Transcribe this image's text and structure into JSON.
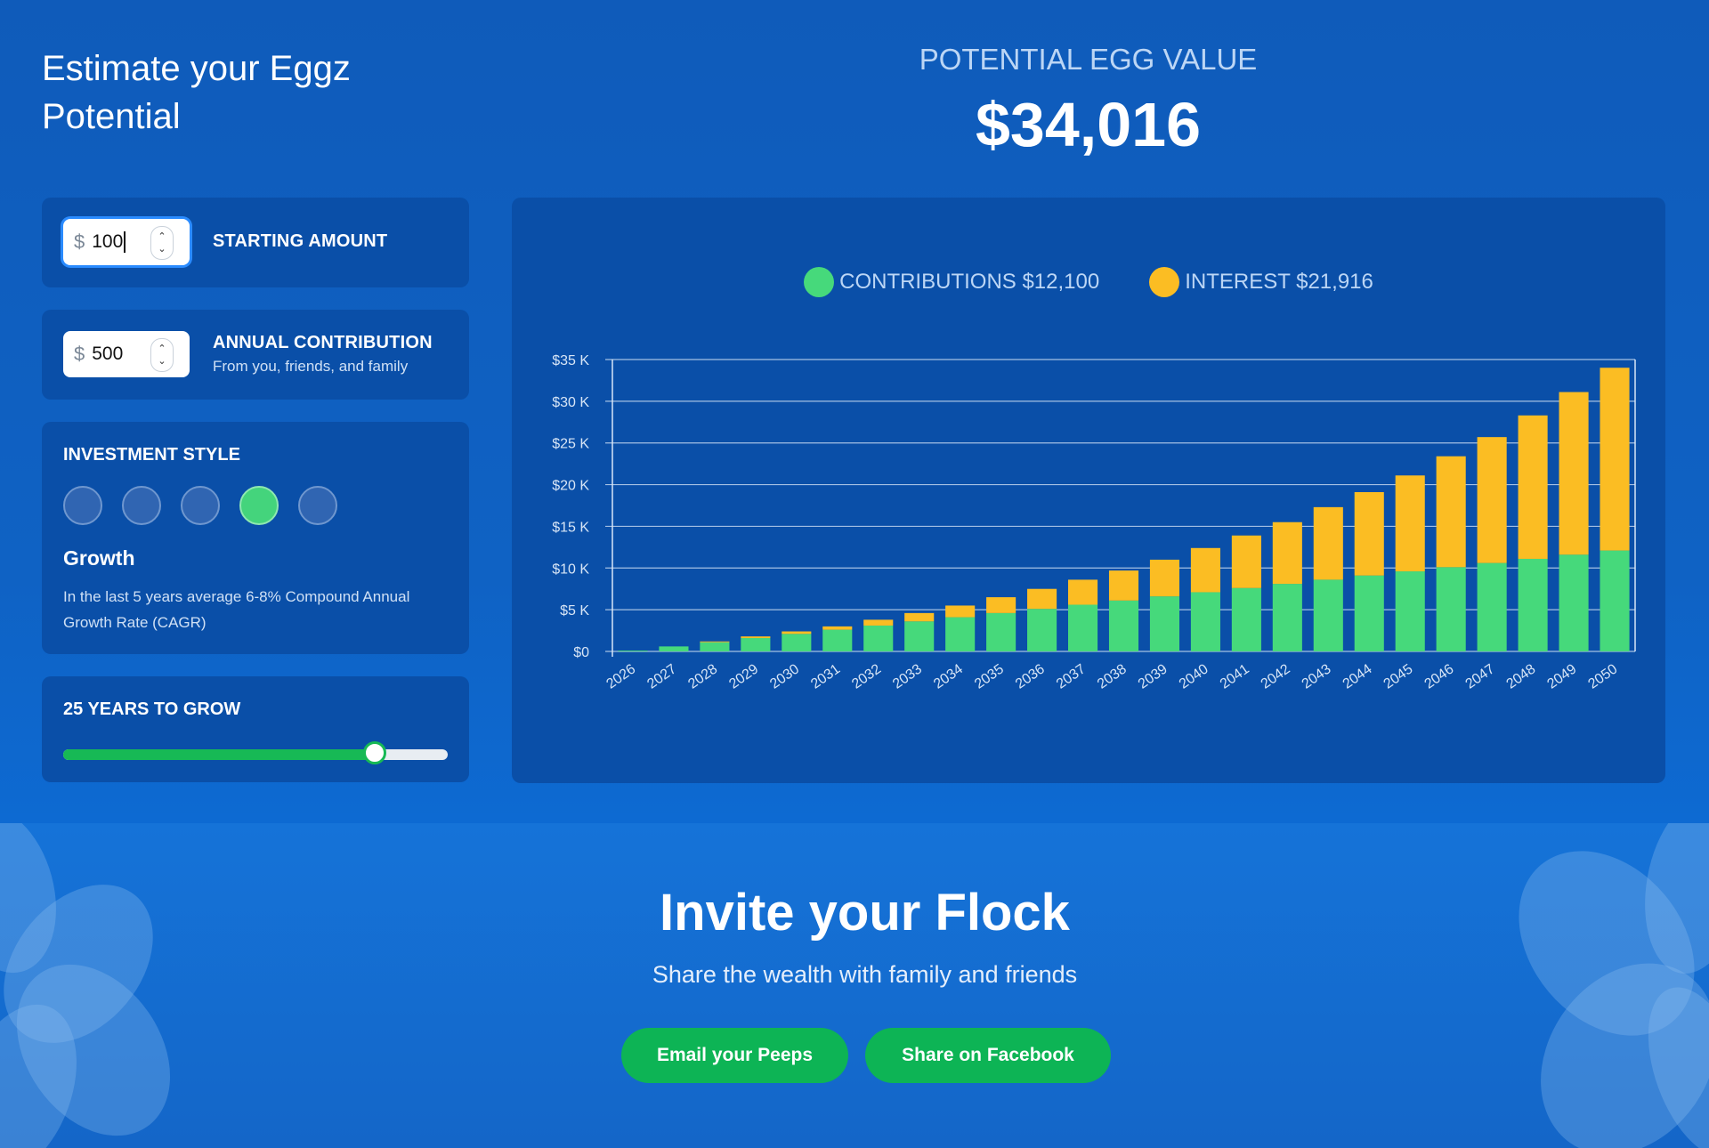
{
  "page": {
    "title": "Estimate your Eggz Potential"
  },
  "starting_amount": {
    "currency": "$",
    "value": "100",
    "label": "STARTING AMOUNT"
  },
  "annual_contribution": {
    "currency": "$",
    "value": "500",
    "label": "ANNUAL CONTRIBUTION",
    "sub": "From you, friends, and family"
  },
  "investment_style": {
    "label": "INVESTMENT STYLE",
    "options_count": 5,
    "selected_index": 3,
    "selected_name": "Growth",
    "description": "In the last 5 years average 6-8% Compound Annual Growth Rate (CAGR)"
  },
  "years": {
    "label": "25 YEARS TO GROW",
    "value": 25,
    "fill_fraction": 0.81
  },
  "potential": {
    "label": "POTENTIAL EGG VALUE",
    "amount": "$34,016"
  },
  "legend": {
    "contributions": "CONTRIBUTIONS $12,100",
    "interest": "INTEREST $21,916"
  },
  "colors": {
    "contributions": "#46d97b",
    "interest": "#fbbd23",
    "accent_green": "#0db455"
  },
  "chart_data": {
    "type": "bar",
    "stacked": true,
    "categories": [
      "2026",
      "2027",
      "2028",
      "2029",
      "2030",
      "2031",
      "2032",
      "2033",
      "2034",
      "2035",
      "2036",
      "2037",
      "2038",
      "2039",
      "2040",
      "2041",
      "2042",
      "2043",
      "2044",
      "2045",
      "2046",
      "2047",
      "2048",
      "2049",
      "2050"
    ],
    "series": [
      {
        "name": "CONTRIBUTIONS",
        "values": [
          100,
          600,
          1100,
          1600,
          2100,
          2600,
          3100,
          3600,
          4100,
          4600,
          5100,
          5600,
          6100,
          6600,
          7100,
          7600,
          8100,
          8600,
          9100,
          9600,
          10100,
          10600,
          11100,
          11600,
          12100
        ]
      },
      {
        "name": "INTEREST",
        "values": [
          0,
          0,
          100,
          200,
          300,
          400,
          700,
          1000,
          1400,
          1900,
          2400,
          3000,
          3600,
          4400,
          5300,
          6300,
          7400,
          8700,
          10000,
          11500,
          13300,
          15100,
          17200,
          19500,
          21916
        ]
      }
    ],
    "y_ticks": [
      "$0",
      "$5 K",
      "$10 K",
      "$15 K",
      "$20 K",
      "$25 K",
      "$30 K",
      "$35 K"
    ],
    "ylim": [
      0,
      35000
    ],
    "grid": true
  },
  "invite": {
    "title": "Invite your Flock",
    "subtitle": "Share the wealth with family and friends",
    "email_button": "Email your Peeps",
    "facebook_button": "Share on Facebook"
  }
}
